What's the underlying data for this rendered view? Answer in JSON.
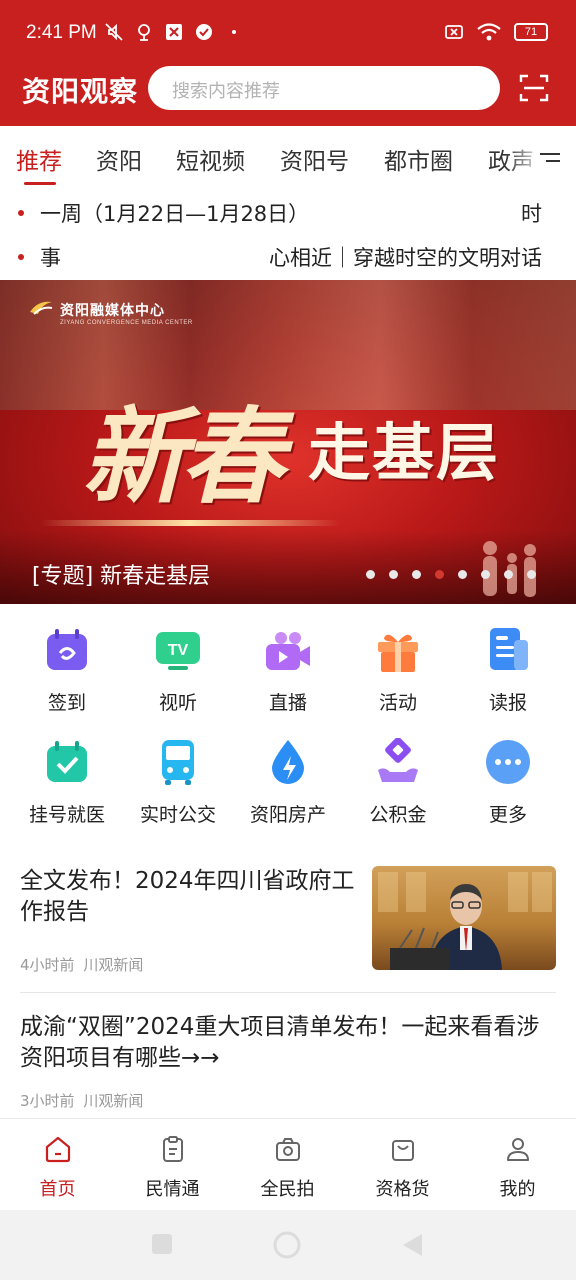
{
  "status_bar": {
    "time": "2:41 PM",
    "battery": "71"
  },
  "header": {
    "logo": "资阳观察",
    "search_placeholder": "搜索内容推荐"
  },
  "tabs": [
    {
      "label": "推荐",
      "active": true
    },
    {
      "label": "资阳"
    },
    {
      "label": "短视频"
    },
    {
      "label": "资阳号"
    },
    {
      "label": "都市圈"
    },
    {
      "label": "政声"
    }
  ],
  "ticker": [
    {
      "left": "一周（1月22日—1月28日）",
      "right": "时"
    },
    {
      "left": "事",
      "right": "心相近｜穿越时空的文明对话"
    }
  ],
  "banner": {
    "logo_text": "资阳融媒体中心",
    "logo_sub": "ZIYANG CONVERGENCE MEDIA CENTER",
    "title_part1": "新春",
    "title_part2": "走基层",
    "caption": "[专题] 新春走基层",
    "dot_count": 8,
    "active_dot": 3
  },
  "quick_grid": [
    {
      "label": "签到",
      "icon": "calendar-sign-icon",
      "color": "#7b5cf0"
    },
    {
      "label": "视听",
      "icon": "tv-icon",
      "color": "#2fcf8e"
    },
    {
      "label": "直播",
      "icon": "live-camera-icon",
      "color": "#b06af5"
    },
    {
      "label": "活动",
      "icon": "gift-icon",
      "color": "#ff7a3d"
    },
    {
      "label": "读报",
      "icon": "newspaper-icon",
      "color": "#3d8bf5"
    },
    {
      "label": "挂号就医",
      "icon": "medical-calendar-icon",
      "color": "#22c7a8"
    },
    {
      "label": "实时公交",
      "icon": "bus-icon",
      "color": "#26b7f0"
    },
    {
      "label": "资阳房产",
      "icon": "housing-drop-icon",
      "color": "#2a8ef5"
    },
    {
      "label": "公积金",
      "icon": "fund-icon",
      "color": "#8b4ef0"
    },
    {
      "label": "更多",
      "icon": "more-icon",
      "color": "#3d8bf5"
    }
  ],
  "news": [
    {
      "title": "全文发布！2024年四川省政府工作报告",
      "time": "4小时前",
      "source": "川观新闻"
    },
    {
      "title": "成渝“双圈”2024重大项目清单发布！一起来看看涉资阳项目有哪些→→",
      "time": "3小时前",
      "source": "川观新闻"
    }
  ],
  "bottom_nav": [
    {
      "label": "首页",
      "icon": "home-icon",
      "active": true
    },
    {
      "label": "民情通",
      "icon": "clipboard-icon"
    },
    {
      "label": "全民拍",
      "icon": "camera-icon"
    },
    {
      "label": "资格货",
      "icon": "shopping-bag-icon"
    },
    {
      "label": "我的",
      "icon": "user-icon"
    }
  ],
  "colors": {
    "brand_red": "#c7201f"
  }
}
